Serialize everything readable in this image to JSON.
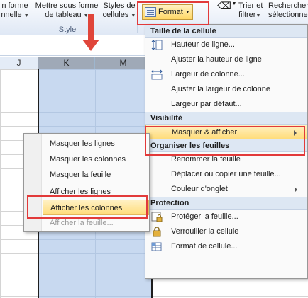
{
  "ribbon": {
    "btn_table_style": "n forme",
    "btn_table_style_sub": "nnelle",
    "btn_format_as_table": "Mettre sous forme",
    "btn_format_as_table_sub": "de tableau",
    "btn_cell_styles": "Styles de",
    "btn_cell_styles_sub": "cellules",
    "group_label": "Style",
    "format_label": "Format",
    "sort_label": "Trier et",
    "sort_label_sub": "filtrer",
    "find_label": "Rechercher",
    "find_label_sub": "sélectionne"
  },
  "columns": [
    "J",
    "K",
    "M"
  ],
  "format_menu": {
    "sections": [
      {
        "heading": "Taille de la cellule",
        "items": [
          {
            "label": "Hauteur de ligne...",
            "icon": "row-height-icon"
          },
          {
            "label": "Ajuster la hauteur de ligne",
            "icon": ""
          },
          {
            "label": "Largeur de colonne...",
            "icon": "column-width-icon"
          },
          {
            "label": "Ajuster la largeur de colonne",
            "icon": ""
          },
          {
            "label": "Largeur par défaut...",
            "icon": ""
          }
        ]
      },
      {
        "heading": "Visibilité",
        "items": [
          {
            "label": "Masquer & afficher",
            "icon": "",
            "highlighted": true,
            "submenu": true
          }
        ]
      },
      {
        "heading": "Organiser les feuilles",
        "items": [
          {
            "label": "Renommer la feuille",
            "icon": ""
          },
          {
            "label": "Déplacer ou copier une feuille...",
            "icon": ""
          },
          {
            "label": "Couleur d'onglet",
            "icon": "",
            "submenu": true
          }
        ]
      },
      {
        "heading": "Protection",
        "items": [
          {
            "label": "Protéger la feuille...",
            "icon": "protect-sheet-icon"
          },
          {
            "label": "Verrouiller la cellule",
            "icon": "lock-icon"
          },
          {
            "label": "Format de cellule...",
            "icon": "format-cells-icon"
          }
        ]
      }
    ]
  },
  "hide_show_menu": {
    "items": [
      {
        "label": "Masquer les lignes"
      },
      {
        "label": "Masquer les colonnes"
      },
      {
        "label": "Masquer la feuille"
      },
      {
        "label": "Afficher les lignes"
      },
      {
        "label": "Afficher les colonnes",
        "highlighted": true
      },
      {
        "label": "Afficher la feuille...",
        "disabled": true
      }
    ]
  },
  "colors": {
    "annotation_red": "#e23a3a",
    "menu_highlight": "#ffdc7a",
    "selected_column": "#c8d9f0"
  }
}
